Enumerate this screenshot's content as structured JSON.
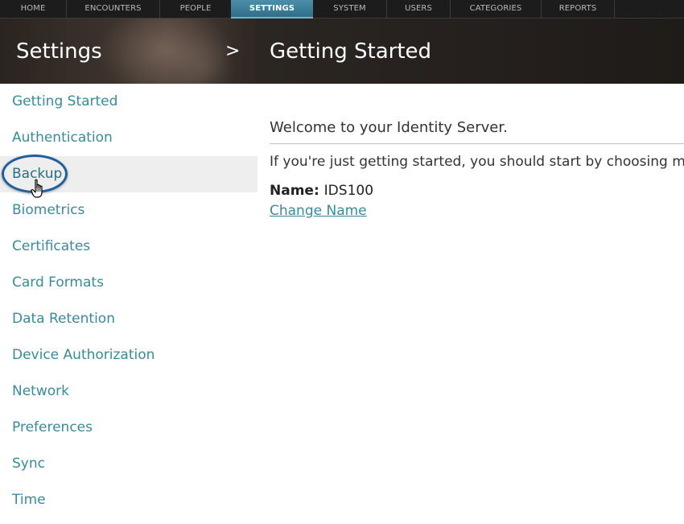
{
  "topnav": {
    "tabs": [
      {
        "label": "HOME",
        "active": false
      },
      {
        "label": "ENCOUNTERS",
        "active": false
      },
      {
        "label": "PEOPLE",
        "active": false
      },
      {
        "label": "SETTINGS",
        "active": true
      },
      {
        "label": "SYSTEM",
        "active": false
      },
      {
        "label": "USERS",
        "active": false
      },
      {
        "label": "CATEGORIES",
        "active": false
      },
      {
        "label": "REPORTS",
        "active": false
      }
    ]
  },
  "header": {
    "section_title": "Settings",
    "expand_symbol": ">",
    "page_title": "Getting Started"
  },
  "sidebar": {
    "selected": "Backup",
    "items": [
      {
        "label": "Getting Started"
      },
      {
        "label": "Authentication"
      },
      {
        "label": "Backup"
      },
      {
        "label": "Biometrics"
      },
      {
        "label": "Certificates"
      },
      {
        "label": "Card Formats"
      },
      {
        "label": "Data Retention"
      },
      {
        "label": "Device Authorization"
      },
      {
        "label": "Network"
      },
      {
        "label": "Preferences"
      },
      {
        "label": "Sync"
      },
      {
        "label": "Time"
      }
    ]
  },
  "main": {
    "welcome": "Welcome to your Identity Server.",
    "intro": "If you're just getting started, you should start by choosing meanin",
    "name_label": "Name:",
    "name_value": "IDS100",
    "change_name_link": "Change Name"
  },
  "colors": {
    "accent_link": "#3b8a98",
    "active_tab": "#2e6f8a",
    "highlight_ring": "#1f5f9a"
  },
  "icons": {
    "cursor": "hand-pointer-icon",
    "expand": "chevron-right-icon"
  }
}
